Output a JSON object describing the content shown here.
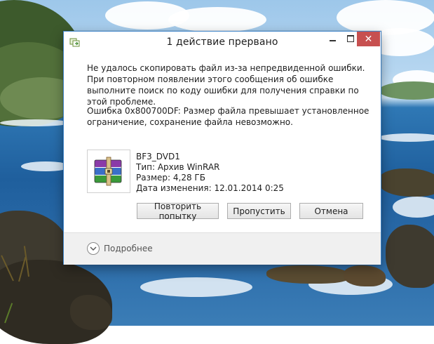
{
  "window": {
    "title": "1 действие прервано",
    "close_glyph": "✕"
  },
  "message": {
    "main": "Не удалось скопировать файл из-за непредвиденной ошибки. При повторном появлении этого сообщения об ошибке выполните поиск по коду ошибки для получения справки по этой проблеме.",
    "error": "Ошибка 0x800700DF: Размер файла превышает установленное ограничение, сохранение файла невозможно."
  },
  "file": {
    "name": "BF3_DVD1",
    "type": "Тип: Архив WinRAR",
    "size": "Размер: 4,28 ГБ",
    "modified": "Дата изменения: 12.01.2014 0:25",
    "icon": "winrar-archive-icon"
  },
  "buttons": {
    "retry": "Повторить попытку",
    "skip": "Пропустить",
    "cancel": "Отмена"
  },
  "footer": {
    "details": "Подробнее",
    "icon": "chevron-down-icon"
  },
  "colors": {
    "window_border": "#3f84c8",
    "close_button": "#c75050",
    "footer_bg": "#f0f0f0"
  }
}
